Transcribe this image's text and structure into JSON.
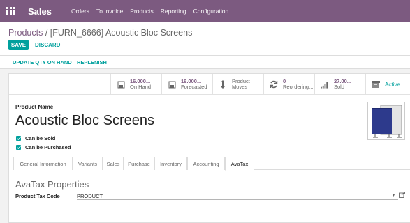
{
  "navbar": {
    "app_name": "Sales",
    "menu": [
      "Orders",
      "To Invoice",
      "Products",
      "Reporting",
      "Configuration"
    ],
    "color": "#7c5a80"
  },
  "breadcrumb": {
    "parent": "Products",
    "separator": " / ",
    "current": "[FURN_6666] Acoustic Bloc Screens"
  },
  "buttons": {
    "save": "SAVE",
    "discard": "DISCARD"
  },
  "actions": {
    "update_qty": "UPDATE QTY ON HAND",
    "replenish": "REPLENISH"
  },
  "stats": {
    "on_hand": {
      "value": "16.000...",
      "label": "On Hand",
      "icon": "building-icon"
    },
    "forecasted": {
      "value": "16.000...",
      "label": "Forecasted",
      "icon": "building-icon"
    },
    "moves": {
      "line1": "Product",
      "line2": "Moves",
      "icon": "up-down-arrows-icon"
    },
    "reordering": {
      "value": "0",
      "label": "Reordering...",
      "icon": "refresh-icon"
    },
    "sold": {
      "value": "27.00...",
      "label": "Sold",
      "icon": "bar-chart-icon"
    },
    "active": {
      "label": "Active",
      "icon": "archive-icon"
    }
  },
  "form": {
    "product_name_label": "Product Name",
    "product_name": "Acoustic Bloc Screens",
    "can_be_sold": "Can be Sold",
    "can_be_purchased": "Can be Purchased"
  },
  "tabs": [
    "General Information",
    "Variants",
    "Sales",
    "Purchase",
    "Inventory",
    "Accounting",
    "AvaTax"
  ],
  "active_tab": "AvaTax",
  "avatax": {
    "section_title": "AvaTax Properties",
    "tax_code_label": "Product Tax Code",
    "tax_code_value": "PRODUCT"
  },
  "accent_color": "#00a09d"
}
